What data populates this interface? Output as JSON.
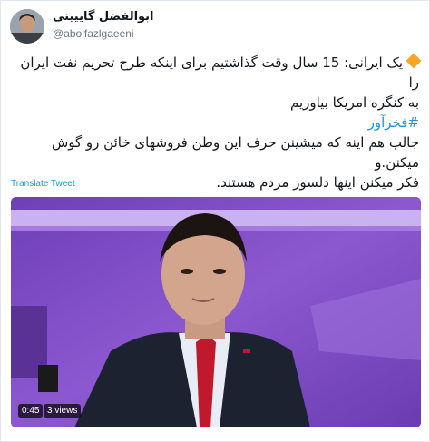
{
  "user": {
    "display_name": "ابوالفضل گاییینی",
    "handle": "@abolfazlgaeeni"
  },
  "tweet": {
    "line1": "یک ایرانی: 15 سال وقت گذاشتیم برای اینکه طرح تحریم نفت ایران را",
    "line2": "به کنگره امریکا بیاوریم",
    "hashtag": "#فخرآور",
    "line3": "جالب هم اینه که میشینن حرف این وطن فروشهای خائن رو گوش میکنن.و",
    "line4": "فکر میکنن اینها دلسوز مردم هستند."
  },
  "translate_label": "Translate Tweet",
  "video": {
    "duration": "0:45",
    "views": "3 views"
  },
  "colors": {
    "link": "#1b95e0",
    "bullet": "#f5a623",
    "secondary_text": "#657786"
  },
  "icons": {
    "bullet": "orange-diamond-icon"
  }
}
